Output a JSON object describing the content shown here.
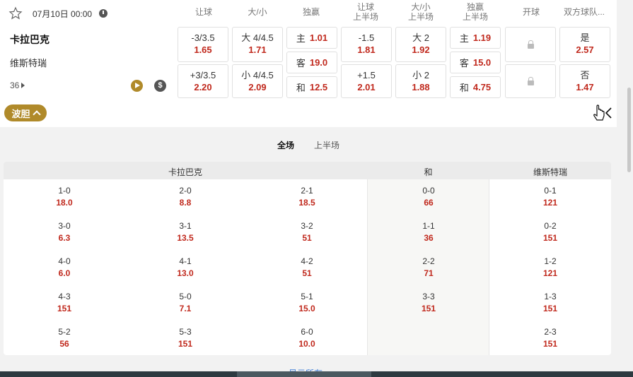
{
  "match": {
    "datetime": "07月10日 00:00",
    "home": "卡拉巴克",
    "away": "维斯特瑞",
    "more_count": "36"
  },
  "columns": {
    "handicap": "让球",
    "ou": "大/小",
    "win1x2": "独赢",
    "handicap_half_l1": "让球",
    "handicap_half_l2": "上半场",
    "ou_half_l1": "大/小",
    "ou_half_l2": "上半场",
    "win1x2_half_l1": "独赢",
    "win1x2_half_l2": "上半场",
    "kickoff": "开球",
    "btts": "双方球队..."
  },
  "odds": {
    "handicap": [
      {
        "line": "-3/3.5",
        "odd": "1.65"
      },
      {
        "line": "+3/3.5",
        "odd": "2.20"
      }
    ],
    "ou": [
      {
        "line": "大 4/4.5",
        "odd": "1.71"
      },
      {
        "line": "小 4/4.5",
        "odd": "2.09"
      }
    ],
    "win1x2": [
      {
        "line": "主",
        "odd": "1.01"
      },
      {
        "line": "客",
        "odd": "19.0"
      },
      {
        "line": "和",
        "odd": "12.5"
      }
    ],
    "handicap_half": [
      {
        "line": "-1.5",
        "odd": "1.81"
      },
      {
        "line": "+1.5",
        "odd": "2.01"
      }
    ],
    "ou_half": [
      {
        "line": "大 2",
        "odd": "1.92"
      },
      {
        "line": "小 2",
        "odd": "1.88"
      }
    ],
    "win1x2_half": [
      {
        "line": "主",
        "odd": "1.19"
      },
      {
        "line": "客",
        "odd": "15.0"
      },
      {
        "line": "和",
        "odd": "4.75"
      }
    ],
    "btts": [
      {
        "line": "是",
        "odd": "2.57"
      },
      {
        "line": "否",
        "odd": "1.47"
      }
    ]
  },
  "bodan": {
    "label": "波胆"
  },
  "tabs": [
    {
      "label": "全场",
      "active": true
    },
    {
      "label": "上半场",
      "active": false
    }
  ],
  "correct_score": {
    "headers": {
      "home": "卡拉巴克",
      "draw": "和",
      "away": "维斯特瑞"
    },
    "home_cols": [
      [
        {
          "s": "1-0",
          "o": "18.0"
        },
        {
          "s": "3-0",
          "o": "6.3"
        },
        {
          "s": "4-0",
          "o": "6.0"
        },
        {
          "s": "4-3",
          "o": "151"
        },
        {
          "s": "5-2",
          "o": "56"
        }
      ],
      [
        {
          "s": "2-0",
          "o": "8.8"
        },
        {
          "s": "3-1",
          "o": "13.5"
        },
        {
          "s": "4-1",
          "o": "13.0"
        },
        {
          "s": "5-0",
          "o": "7.1"
        },
        {
          "s": "5-3",
          "o": "151"
        }
      ],
      [
        {
          "s": "2-1",
          "o": "18.5"
        },
        {
          "s": "3-2",
          "o": "51"
        },
        {
          "s": "4-2",
          "o": "51"
        },
        {
          "s": "5-1",
          "o": "15.0"
        },
        {
          "s": "6-0",
          "o": "10.0"
        }
      ]
    ],
    "draw_col": [
      {
        "s": "0-0",
        "o": "66"
      },
      {
        "s": "1-1",
        "o": "36"
      },
      {
        "s": "2-2",
        "o": "71"
      },
      {
        "s": "3-3",
        "o": "151"
      }
    ],
    "away_col": [
      {
        "s": "0-1",
        "o": "121"
      },
      {
        "s": "0-2",
        "o": "151"
      },
      {
        "s": "1-2",
        "o": "121"
      },
      {
        "s": "1-3",
        "o": "151"
      },
      {
        "s": "2-3",
        "o": "151"
      }
    ]
  },
  "show_all": "显示所有",
  "colors": {
    "accent": "#b08a2a",
    "odd": "#c0281c"
  }
}
